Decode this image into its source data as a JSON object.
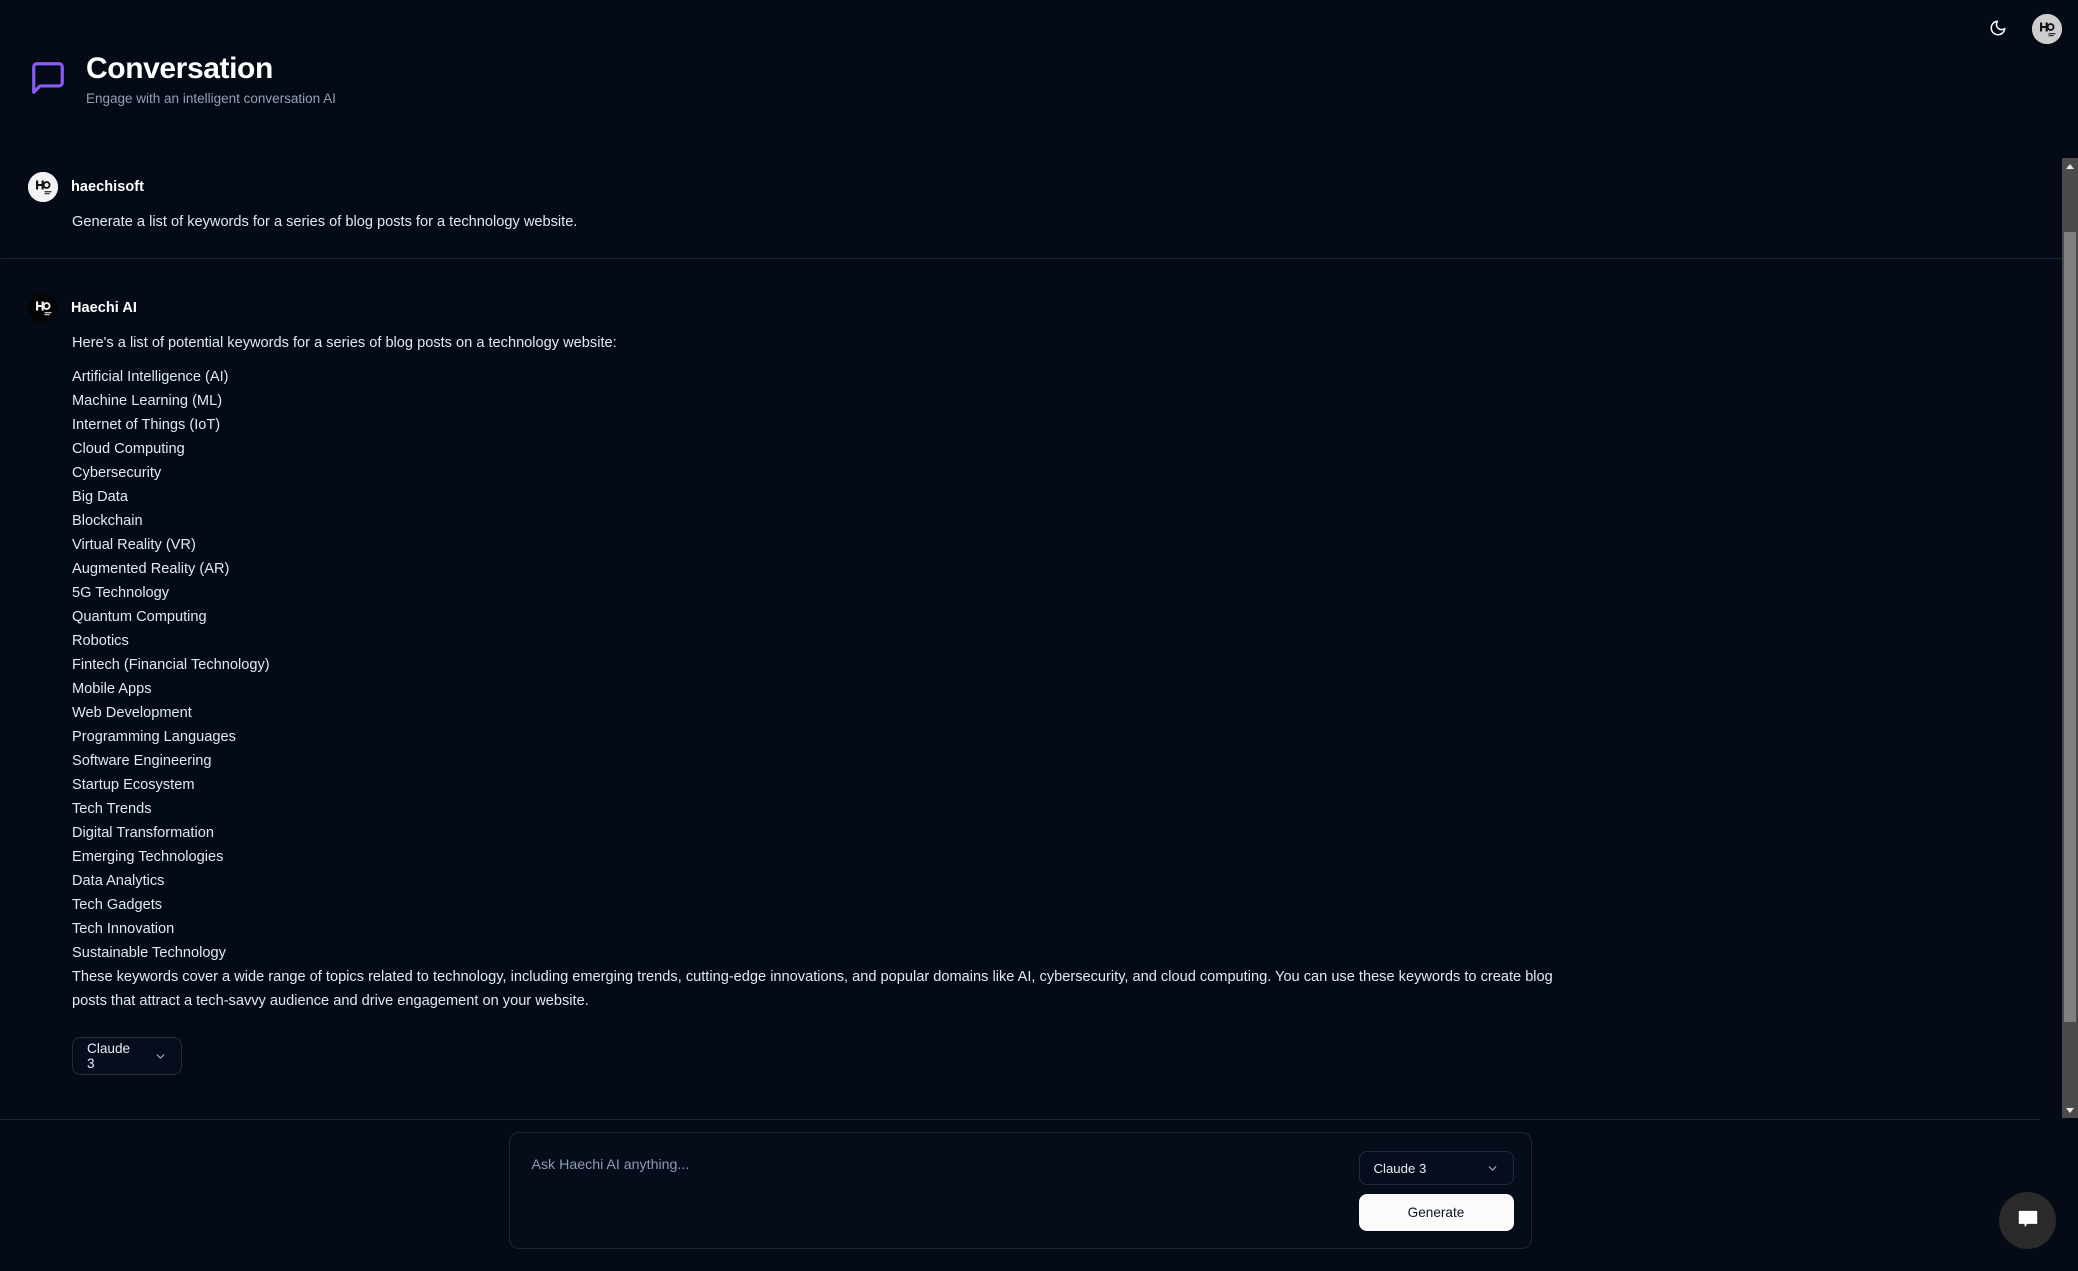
{
  "topbar": {
    "theme_toggle_icon": "moon-icon",
    "avatar_alt": "haechisoft-avatar"
  },
  "header": {
    "logo_icon": "speech-bubble-icon",
    "title": "Conversation",
    "subtitle": "Engage with an intelligent conversation AI"
  },
  "messages": [
    {
      "author": "haechisoft",
      "role": "user",
      "text": "Generate a list of keywords for a series of blog posts for a technology website."
    },
    {
      "author": "Haechi AI",
      "role": "assistant",
      "intro": "Here's a list of potential keywords for a series of blog posts on a technology website:",
      "keywords": [
        "Artificial Intelligence (AI)",
        "Machine Learning (ML)",
        "Internet of Things (IoT)",
        "Cloud Computing",
        "Cybersecurity",
        "Big Data",
        "Blockchain",
        "Virtual Reality (VR)",
        "Augmented Reality (AR)",
        "5G Technology",
        "Quantum Computing",
        "Robotics",
        "Fintech (Financial Technology)",
        "Mobile Apps",
        "Web Development",
        "Programming Languages",
        "Software Engineering",
        "Startup Ecosystem",
        "Tech Trends",
        "Digital Transformation",
        "Emerging Technologies",
        "Data Analytics",
        "Tech Gadgets",
        "Tech Innovation",
        "Sustainable Technology"
      ],
      "closing": "These keywords cover a wide range of topics related to technology, including emerging trends, cutting-edge innovations, and popular domains like AI, cybersecurity, and cloud computing. You can use these keywords to create blog posts that attract a tech-savvy audience and drive engagement on your website.",
      "model_selected": "Claude 3"
    }
  ],
  "composer": {
    "placeholder": "Ask Haechi AI anything...",
    "model_selected": "Claude 3",
    "generate_label": "Generate"
  },
  "fab": {
    "icon": "chat-bubble-icon"
  },
  "colors": {
    "background": "#050a17",
    "accent": "#8b5cf6",
    "divider": "#1b2336",
    "text_primary": "#e3e9f2",
    "text_muted": "#94a0b4",
    "button_bg": "#fbfbfc",
    "scrollbar_track": "#4b4b4b",
    "scrollbar_thumb": "#808080"
  }
}
